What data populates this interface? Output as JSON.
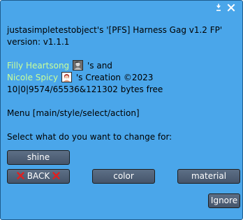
{
  "dialog": {
    "title_line": "justasimpletestobject's '[PFS] Harness Gag v1.2 FP'",
    "version_line": "version: v1.1.1",
    "creator1_name": "Filly Heartsong",
    "creator1_suffix": " 's and",
    "creator2_name": "Nicole Spicy",
    "creator2_suffix": " 's Creation ©2023",
    "memory_line": "10|0|9574/65536&121302 bytes free",
    "menu_line": "Menu [main/style/select/action]",
    "prompt_line": "Select what do you want to change for:"
  },
  "buttons": {
    "shine": "shine",
    "back": "BACK",
    "color": "color",
    "material": "material",
    "ignore": "Ignore"
  },
  "colors": {
    "dialog_bg": "#4aa6ea",
    "link": "#c8ff9a",
    "button_bg": "#52627a",
    "x_mark": "#e02020"
  }
}
